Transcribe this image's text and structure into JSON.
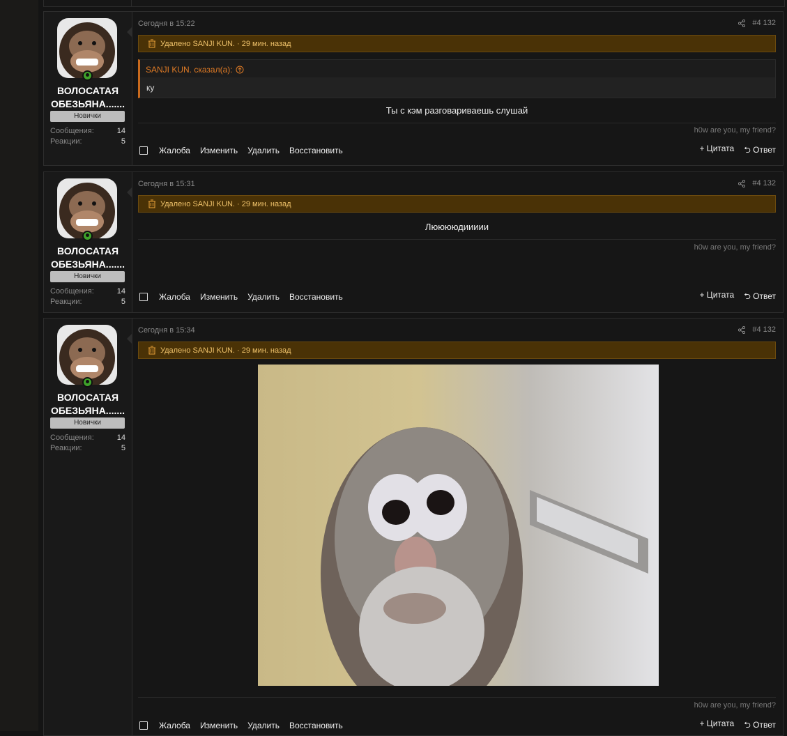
{
  "posts": [
    {
      "date": "Сегодня в 15:22",
      "number": "#4 132",
      "deleted_text": "Удалено SANJI KUN. · 29 мин. назад",
      "quote": {
        "author": "SANJI KUN. сказал(а):",
        "text": "ку"
      },
      "message": "Ты с кэм разговариваешь слушай",
      "signature": "h0w are you, my friend?"
    },
    {
      "date": "Сегодня в 15:31",
      "number": "#4 132",
      "deleted_text": "Удалено SANJI KUN. · 29 мин. назад",
      "message": "Лююююдиииии",
      "signature": "h0w are you, my friend?"
    },
    {
      "date": "Сегодня в 15:34",
      "number": "#4 132",
      "deleted_text": "Удалено SANJI KUN. · 29 мин. назад",
      "signature": "h0w are you, my friend?"
    }
  ],
  "user": {
    "name_line1": "ВОЛОСАТАЯ",
    "name_line2": "ОБЕЗЬЯНА.......",
    "role": "Новички",
    "messages_label": "Сообщения:",
    "messages_value": "14",
    "reactions_label": "Реакции:",
    "reactions_value": "5"
  },
  "actions": {
    "report": "Жалоба",
    "edit": "Изменить",
    "delete": "Удалить",
    "restore": "Восстановить",
    "quote": "+ Цитата",
    "reply": "Ответ"
  },
  "colors": {
    "deleted_bg": "#4a3206",
    "deleted_text": "#f0c36b",
    "quote_accent": "#c96a1d",
    "online": "#3fa32a"
  }
}
